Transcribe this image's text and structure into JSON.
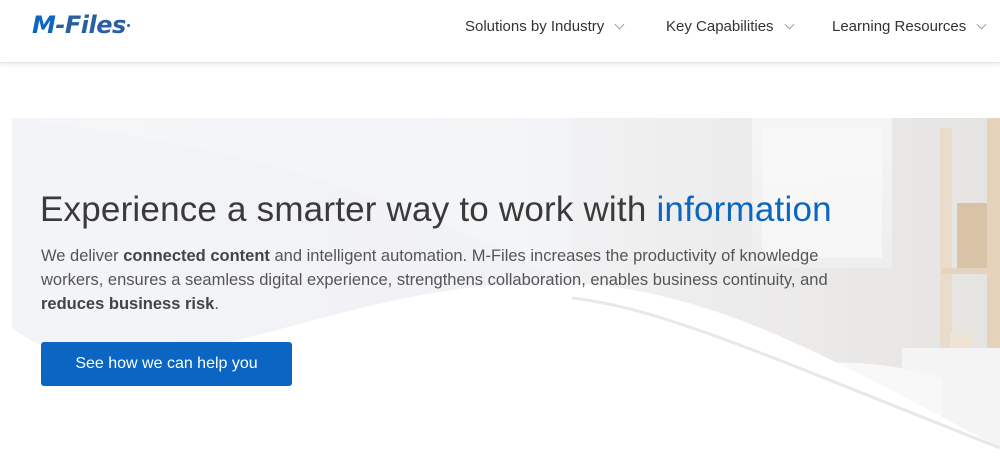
{
  "brand": {
    "logo_text_m": "M",
    "logo_text_rest": "-Files"
  },
  "nav": {
    "items": [
      {
        "label": "Solutions by Industry"
      },
      {
        "label": "Key Capabilities"
      },
      {
        "label": "Learning Resources"
      }
    ]
  },
  "hero": {
    "headline_prefix": "Experience a smarter way to work with ",
    "headline_accent": "information",
    "desc_1": "We deliver ",
    "desc_bold_1": "connected content",
    "desc_2": " and intelligent automation. M-Files increases the productivity of knowledge workers, ensures a seamless digital experience, strengthens collaboration, enables business continuity, and ",
    "desc_bold_2": "reduces business risk",
    "desc_3": ".",
    "cta_label": "See how we can help you"
  },
  "colors": {
    "accent": "#0a66c2",
    "text": "#3a3a3a"
  }
}
